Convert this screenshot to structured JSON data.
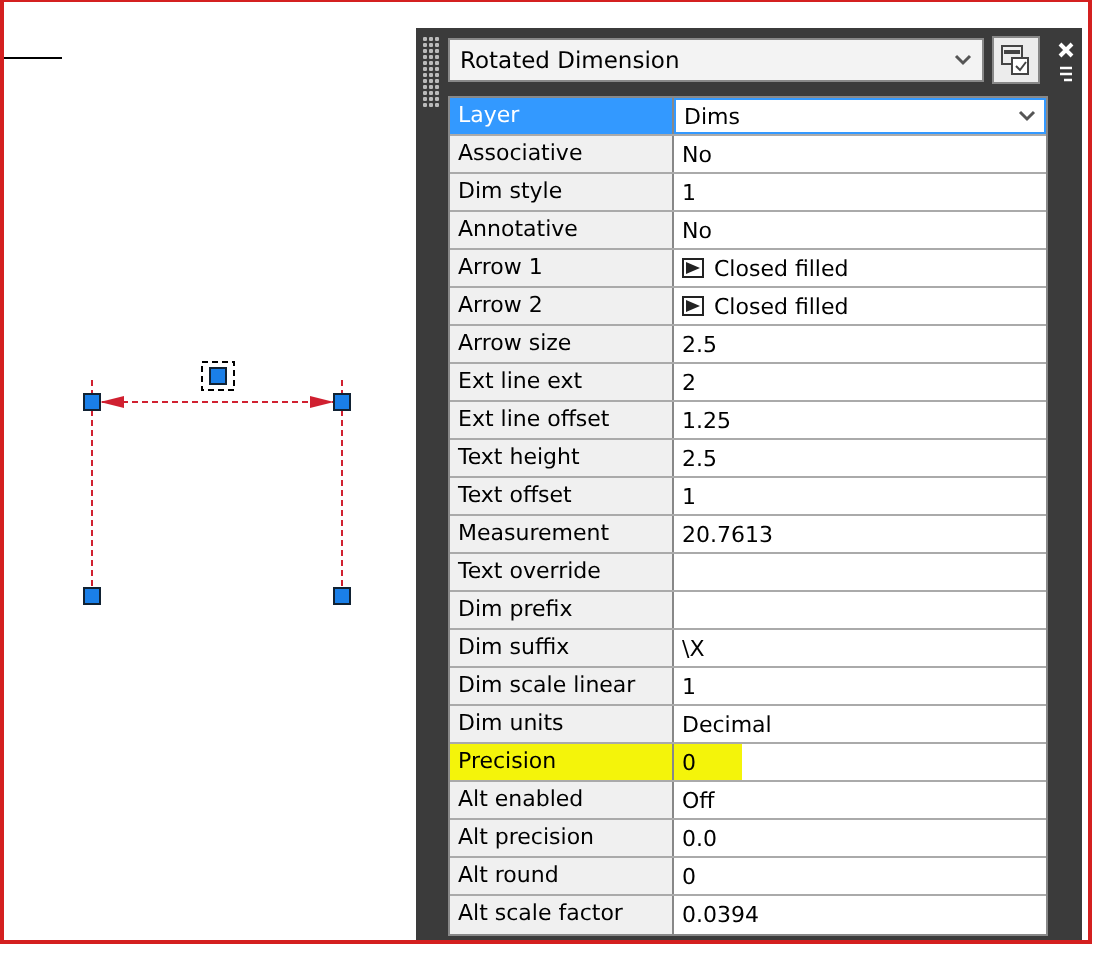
{
  "palette": {
    "object_type": "Rotated Dimension"
  },
  "properties": [
    {
      "label": "Layer",
      "value": "Dims",
      "kind": "dropdown",
      "selected": true,
      "highlighted": false
    },
    {
      "label": "Associative",
      "value": "No",
      "kind": "text",
      "selected": false,
      "highlighted": false
    },
    {
      "label": "Dim style",
      "value": "1",
      "kind": "text",
      "selected": false,
      "highlighted": false
    },
    {
      "label": "Annotative",
      "value": "No",
      "kind": "text",
      "selected": false,
      "highlighted": false
    },
    {
      "label": "Arrow 1",
      "value": "Closed filled",
      "kind": "arrow",
      "selected": false,
      "highlighted": false
    },
    {
      "label": "Arrow 2",
      "value": "Closed filled",
      "kind": "arrow",
      "selected": false,
      "highlighted": false
    },
    {
      "label": "Arrow size",
      "value": "2.5",
      "kind": "text",
      "selected": false,
      "highlighted": false
    },
    {
      "label": "Ext line ext",
      "value": "2",
      "kind": "text",
      "selected": false,
      "highlighted": false
    },
    {
      "label": "Ext line offset",
      "value": "1.25",
      "kind": "text",
      "selected": false,
      "highlighted": false
    },
    {
      "label": "Text height",
      "value": "2.5",
      "kind": "text",
      "selected": false,
      "highlighted": false
    },
    {
      "label": "Text offset",
      "value": "1",
      "kind": "text",
      "selected": false,
      "highlighted": false
    },
    {
      "label": "Measurement",
      "value": "20.7613",
      "kind": "text",
      "selected": false,
      "highlighted": false
    },
    {
      "label": "Text override",
      "kind": "text",
      "selected": false,
      "highlighted": false
    },
    {
      "label": "Dim prefix",
      "kind": "text",
      "selected": false,
      "highlighted": false
    },
    {
      "label": "Dim suffix",
      "value": "\\X",
      "kind": "text",
      "selected": false,
      "highlighted": false
    },
    {
      "label": "Dim scale linear",
      "value": "1",
      "kind": "text",
      "selected": false,
      "highlighted": false
    },
    {
      "label": "Dim units",
      "value": "Decimal",
      "kind": "text",
      "selected": false,
      "highlighted": false
    },
    {
      "label": "Precision",
      "value": "0",
      "kind": "text",
      "selected": false,
      "highlighted": true
    },
    {
      "label": "Alt enabled",
      "value": "Off",
      "kind": "text",
      "selected": false,
      "highlighted": false
    },
    {
      "label": "Alt precision",
      "value": "0.0",
      "kind": "text",
      "selected": false,
      "highlighted": false
    },
    {
      "label": "Alt round",
      "value": "0",
      "kind": "text",
      "selected": false,
      "highlighted": false
    },
    {
      "label": "Alt scale factor",
      "value": "0.0394",
      "kind": "text",
      "selected": false,
      "highlighted": false
    }
  ]
}
